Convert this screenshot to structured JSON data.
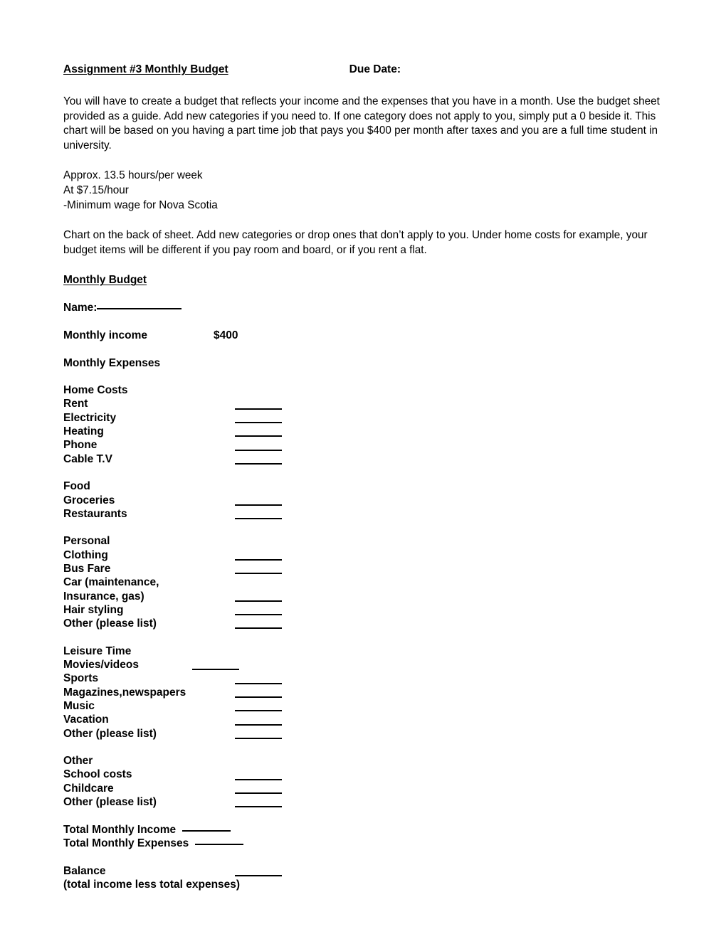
{
  "header": {
    "assignment_title": "Assignment #3 Monthly Budget",
    "due_date_label": "Due Date:"
  },
  "intro": {
    "paragraph": "You will have to create a budget that reflects your income and the expenses that you have in a month.  Use the budget sheet provided as a guide.  Add new categories if you need to.  If one category does not apply to you, simply put a 0 beside it.  This chart will be based on you having a part time job that pays you $400 per month after taxes and you are a full time student in university.",
    "hours_line": "Approx. 13.5 hours/per week",
    "wage_line": "At $7.15/hour",
    "minimum_wage_line": "-Minimum wage for Nova Scotia",
    "chart_note": "Chart on the back of sheet.  Add new categories or drop ones that don’t apply to you. Under home costs for example, your budget items will be different if you pay room and board, or if you rent a flat."
  },
  "budget": {
    "heading": "Monthly Budget",
    "name_label": "Name:",
    "monthly_income_label": "Monthly income",
    "monthly_income_value": "$400",
    "monthly_expenses_label": "Monthly Expenses",
    "sections": [
      {
        "title": "Home Costs",
        "items": [
          {
            "label": "Rent",
            "blank": true
          },
          {
            "label": "Electricity",
            "blank": true
          },
          {
            "label": "Heating",
            "blank": true
          },
          {
            "label": "Phone",
            "blank": true
          },
          {
            "label": "Cable T.V",
            "blank": true
          }
        ]
      },
      {
        "title": "Food",
        "items": [
          {
            "label": "Groceries",
            "blank": true
          },
          {
            "label": "Restaurants",
            "blank": true
          }
        ]
      },
      {
        "title": "Personal",
        "items": [
          {
            "label": "Clothing",
            "blank": true
          },
          {
            "label": "Bus Fare",
            "blank": true
          },
          {
            "label": "Car (maintenance,",
            "blank": false
          },
          {
            "label": "Insurance, gas)",
            "blank": true
          },
          {
            "label": "Hair styling",
            "blank": true
          },
          {
            "label": "Other (please list)",
            "blank": true
          }
        ]
      },
      {
        "title": "Leisure Time",
        "items": [
          {
            "label": "Movies/videos",
            "blank": true,
            "blank_shift_left": true
          },
          {
            "label": "Sports",
            "blank": true
          },
          {
            "label": "Magazines,newspapers",
            "blank": true
          },
          {
            "label": "Music",
            "blank": true
          },
          {
            "label": "Vacation",
            "blank": true
          },
          {
            "label": "Other (please list)",
            "blank": true
          }
        ]
      },
      {
        "title": "Other",
        "items": [
          {
            "label": "School costs",
            "blank": true
          },
          {
            "label": "Childcare",
            "blank": true
          },
          {
            "label": "Other (please list)",
            "blank": true
          }
        ]
      }
    ],
    "totals": {
      "total_income_label": "Total Monthly Income",
      "total_expenses_label": "Total Monthly Expenses",
      "balance_label": "Balance",
      "balance_note": "(total income less total expenses)"
    }
  }
}
